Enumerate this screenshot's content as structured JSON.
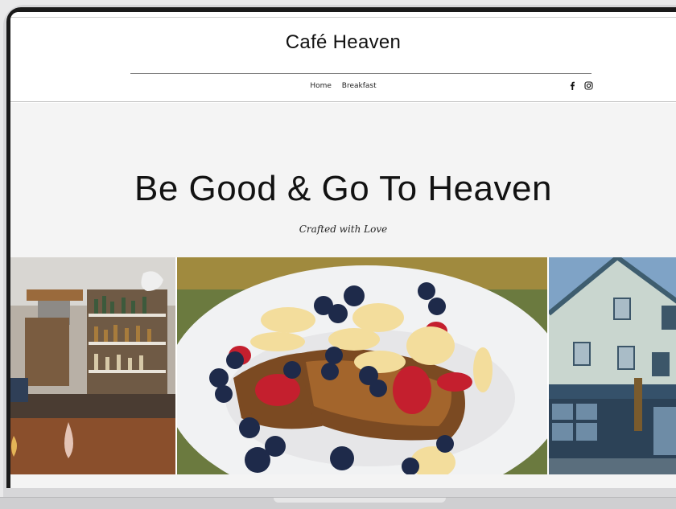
{
  "site": {
    "title": "Café Heaven"
  },
  "nav": {
    "items": [
      "Home",
      "Breakfast"
    ]
  },
  "social": {
    "icons": [
      "facebook-icon",
      "instagram-icon"
    ]
  },
  "hero": {
    "headline": "Be Good & Go To Heaven",
    "tagline": "Crafted with Love"
  },
  "gallery": {
    "images": [
      "bar-interior-photo",
      "french-toast-photo",
      "cafe-building-painting"
    ]
  },
  "colors": {
    "background": "#f4f4f4",
    "text": "#121212",
    "device_frame": "#d7d7d9"
  }
}
